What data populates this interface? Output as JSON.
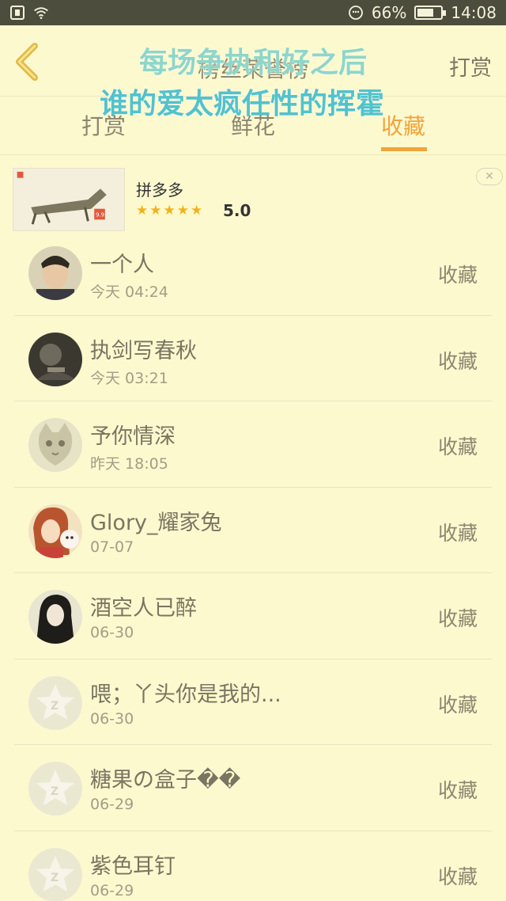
{
  "status_bar": {
    "battery": "66%",
    "time": "14:08",
    "battery_level": 0.66
  },
  "header": {
    "title": "榜丝荣誉榜",
    "right_action": "打赏",
    "lyric_line1": "每场争执和好之后",
    "lyric_line2": "谁的爱太疯任性的挥霍"
  },
  "tabs": [
    {
      "label": "打赏",
      "active": false
    },
    {
      "label": "鲜花",
      "active": false
    },
    {
      "label": "收藏",
      "active": true
    }
  ],
  "ad": {
    "title": "拼多多",
    "rating": "5.0",
    "stars": 5,
    "image_text": "9.9"
  },
  "list": [
    {
      "name": "一个人",
      "time": "今天 04:24",
      "action": "收藏",
      "avatar": "person-photo"
    },
    {
      "name": "执剑写春秋",
      "time": "今天 03:21",
      "action": "收藏",
      "avatar": "dark-photo"
    },
    {
      "name": "予你情深",
      "time": "昨天 18:05",
      "action": "收藏",
      "avatar": "kitten-photo"
    },
    {
      "name": "Glory_耀家兔",
      "time": "07-07",
      "action": "收藏",
      "avatar": "anime-girl"
    },
    {
      "name": "酒空人已醉",
      "time": "06-30",
      "action": "收藏",
      "avatar": "girl-photo"
    },
    {
      "name": "喂；丫头你是我的...",
      "time": "06-30",
      "action": "收藏",
      "avatar": "default-star"
    },
    {
      "name": "糖果の盒子��",
      "time": "06-29",
      "action": "收藏",
      "avatar": "default-star"
    },
    {
      "name": "紫色耳钉",
      "time": "06-29",
      "action": "收藏",
      "avatar": "default-star"
    }
  ],
  "colors": {
    "accent": "#f0a43c",
    "background": "#fdf9cf",
    "lyric": "#52c2cc"
  }
}
